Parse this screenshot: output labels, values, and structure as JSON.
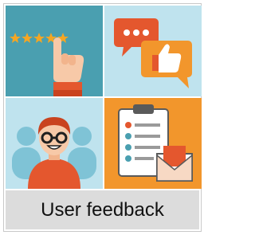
{
  "caption": "User feedback",
  "icons": [
    "star-rating-hand-icon",
    "speech-bubble-thumbs-up-icon",
    "user-avatar-icon",
    "clipboard-checklist-envelope-icon"
  ],
  "colors": {
    "teal": "#4a9fb0",
    "light_blue": "#bfe3ee",
    "orange": "#f2962c",
    "red": "#e4572e",
    "caption_bg": "#dcdcdc"
  }
}
